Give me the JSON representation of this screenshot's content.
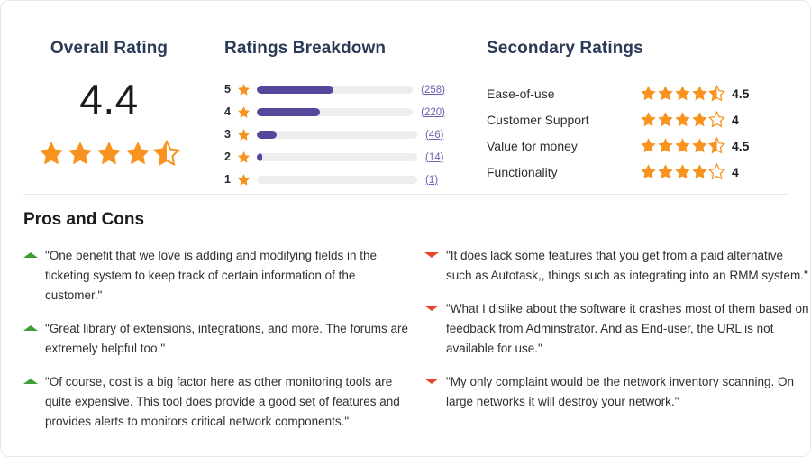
{
  "overall": {
    "title": "Overall Rating",
    "score": "4.4",
    "stars": 4.5,
    "star_icon": "star-icon"
  },
  "breakdown": {
    "title": "Ratings Breakdown",
    "rows": [
      {
        "stars": "5",
        "count": "(258)",
        "count_value": 258,
        "percent": 49.4
      },
      {
        "stars": "4",
        "count": "(220)",
        "count_value": 220,
        "percent": 40.4
      },
      {
        "stars": "3",
        "count": "(46)",
        "count_value": 46,
        "percent": 12.4
      },
      {
        "stars": "2",
        "count": "(14)",
        "count_value": 14,
        "percent": 3.4
      },
      {
        "stars": "1",
        "count": "(1)",
        "count_value": 1,
        "percent": 0
      }
    ]
  },
  "secondary": {
    "title": "Secondary Ratings",
    "rows": [
      {
        "label": "Ease-of-use",
        "value": "4.5",
        "stars": 4.5
      },
      {
        "label": "Customer Support",
        "value": "4",
        "stars": 4
      },
      {
        "label": "Value for money",
        "value": "4.5",
        "stars": 4.5
      },
      {
        "label": "Functionality",
        "value": "4",
        "stars": 4
      }
    ]
  },
  "pros_and_cons": {
    "title": "Pros and Cons",
    "pros": [
      "\"One benefit that we love is adding and modifying fields in the ticketing system to keep track of certain information of the customer.\"",
      "\"Great library of extensions, integrations, and more. The forums are extremely helpful too.\"",
      "\"Of course, cost is a big factor here as other monitoring tools are quite expensive. This tool does provide a good set of features and provides alerts to monitors critical network components.\""
    ],
    "cons": [
      "\"It does lack some features that you get from a paid alternative such as Autotask,, things such as integrating into an RMM system.\"",
      "\"What I dislike about the software it crashes most of them based on feedback from Adminstrator. And as End-user, the URL is not available for use.\"",
      "\"My only complaint would be the network inventory scanning. On large networks it will destroy your network.\""
    ],
    "pro_marker_icon": "triangle-up-icon",
    "con_marker_icon": "triangle-down-icon"
  },
  "colors": {
    "star": "#f7931e",
    "bar_fill": "#54489c",
    "bar_track": "#eceded",
    "count_link": "#6a63b0",
    "heading": "#2b3a57",
    "pro_marker": "#3f9c35",
    "con_marker": "#e8442a"
  }
}
